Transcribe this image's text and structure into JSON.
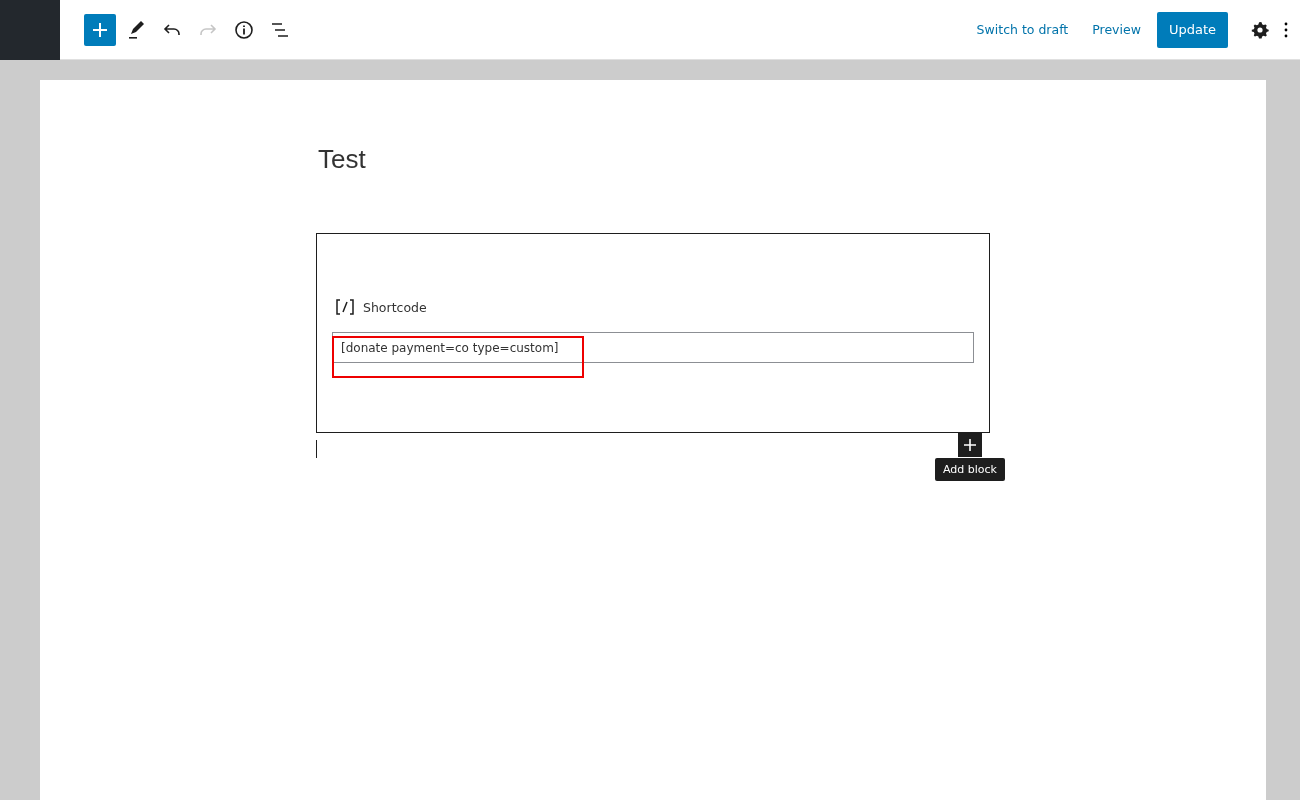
{
  "toolbar": {
    "tools": [
      {
        "kind": "inserter",
        "disabled": false
      },
      {
        "kind": "edit",
        "disabled": false
      },
      {
        "kind": "undo",
        "disabled": false
      },
      {
        "kind": "redo",
        "disabled": true
      },
      {
        "kind": "info",
        "disabled": false
      },
      {
        "kind": "outline",
        "disabled": false
      }
    ],
    "switch_to_draft": "Switch to draft",
    "preview": "Preview",
    "update": "Update"
  },
  "post": {
    "title": "Test",
    "block": {
      "label": "Shortcode",
      "value": "[donate payment=co type=custom]",
      "highlighted": true
    },
    "tooltip": "Add block"
  }
}
